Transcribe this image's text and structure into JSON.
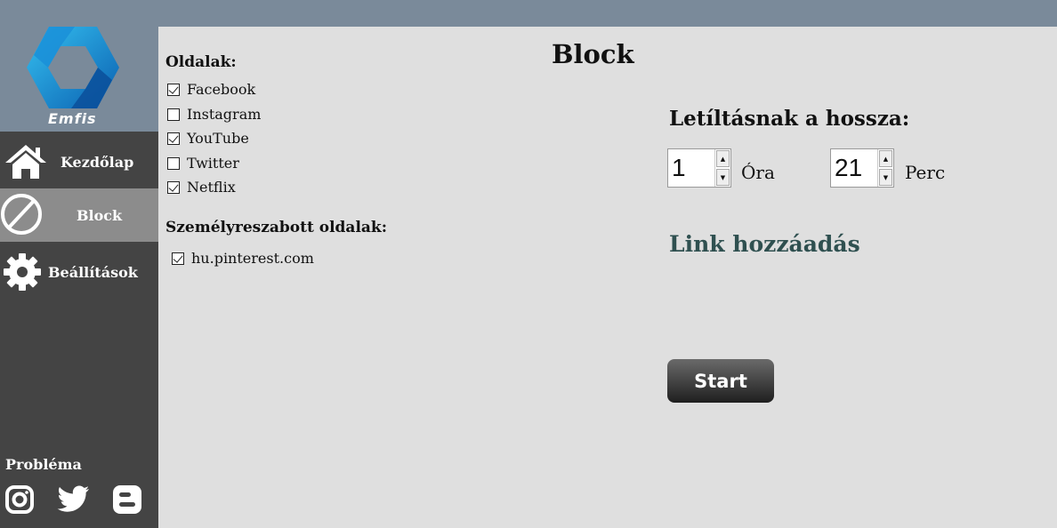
{
  "brand": {
    "name": "Emfis"
  },
  "nav": {
    "items": [
      {
        "label": "Kezdőlap",
        "icon": "home-icon"
      },
      {
        "label": "Block",
        "icon": "block-icon",
        "active": true
      },
      {
        "label": "Beállítások",
        "icon": "gear-icon"
      }
    ]
  },
  "footer": {
    "label": "Probléma",
    "social": [
      "instagram-icon",
      "twitter-icon",
      "blogger-icon"
    ]
  },
  "page": {
    "title": "Block"
  },
  "sites": {
    "title": "Oldalak:",
    "items": [
      {
        "label": "Facebook",
        "checked": true
      },
      {
        "label": "Instagram",
        "checked": false
      },
      {
        "label": "YouTube",
        "checked": true
      },
      {
        "label": "Twitter",
        "checked": false
      },
      {
        "label": "Netflix",
        "checked": true
      }
    ]
  },
  "custom": {
    "title": "Személyreszabott oldalak:",
    "items": [
      {
        "label": "hu.pinterest.com",
        "checked": true
      }
    ]
  },
  "duration": {
    "title": "Letíltásnak a hossza:",
    "hours": {
      "value": "1",
      "unit": "Óra"
    },
    "minutes": {
      "value": "21",
      "unit": "Perc"
    }
  },
  "link_add": "Link hozzáadás",
  "start_label": "Start",
  "colors": {
    "topbar": "#7a8a9a",
    "sidebar": "#444444",
    "active_nav": "#8c8c8c",
    "content_bg": "#dfdfdf",
    "link": "#2f5050"
  }
}
